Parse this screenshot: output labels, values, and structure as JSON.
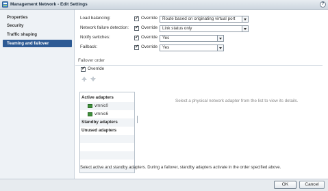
{
  "window": {
    "title": "Management Network - Edit Settings",
    "help_glyph": "?",
    "title_icon": "network-icon"
  },
  "sidebar": {
    "items": [
      {
        "label": "Properties",
        "selected": false
      },
      {
        "label": "Security",
        "selected": false
      },
      {
        "label": "Traffic shaping",
        "selected": false
      },
      {
        "label": "Teaming and failover",
        "selected": true
      }
    ]
  },
  "settings": {
    "load_balancing": {
      "label": "Load balancing:",
      "override_label": "Override",
      "override_checked": true,
      "value": "Route based on originating virtual port"
    },
    "network_failure_detection": {
      "label": "Network failure detection:",
      "override_label": "Override",
      "override_checked": true,
      "value": "Link status only"
    },
    "notify_switches": {
      "label": "Notify switches:",
      "override_label": "Override",
      "override_checked": true,
      "value": "Yes"
    },
    "failback": {
      "label": "Failback:",
      "override_label": "Override",
      "override_checked": true,
      "value": "Yes"
    }
  },
  "failover": {
    "title": "Failover order",
    "override_label": "Override",
    "override_checked": true,
    "move_up_icon": "arrow-up-icon",
    "move_down_icon": "arrow-down-icon",
    "active_header": "Active adapters",
    "active_adapters": [
      "vmnic0",
      "vmnic6"
    ],
    "standby_header": "Standby adapters",
    "unused_header": "Unused adapters",
    "hint": "Select a physical network adapter from the list to view its details.",
    "help": "Select active and standby adapters. During a failover, standby adapters activate in the order specified above."
  },
  "footer": {
    "ok_label": "OK",
    "cancel_label": "Cancel"
  },
  "colors": {
    "selected_nav": "#2d5a94",
    "nic_icon": "#3f8f3a",
    "titlebar": "#ced7e0"
  }
}
